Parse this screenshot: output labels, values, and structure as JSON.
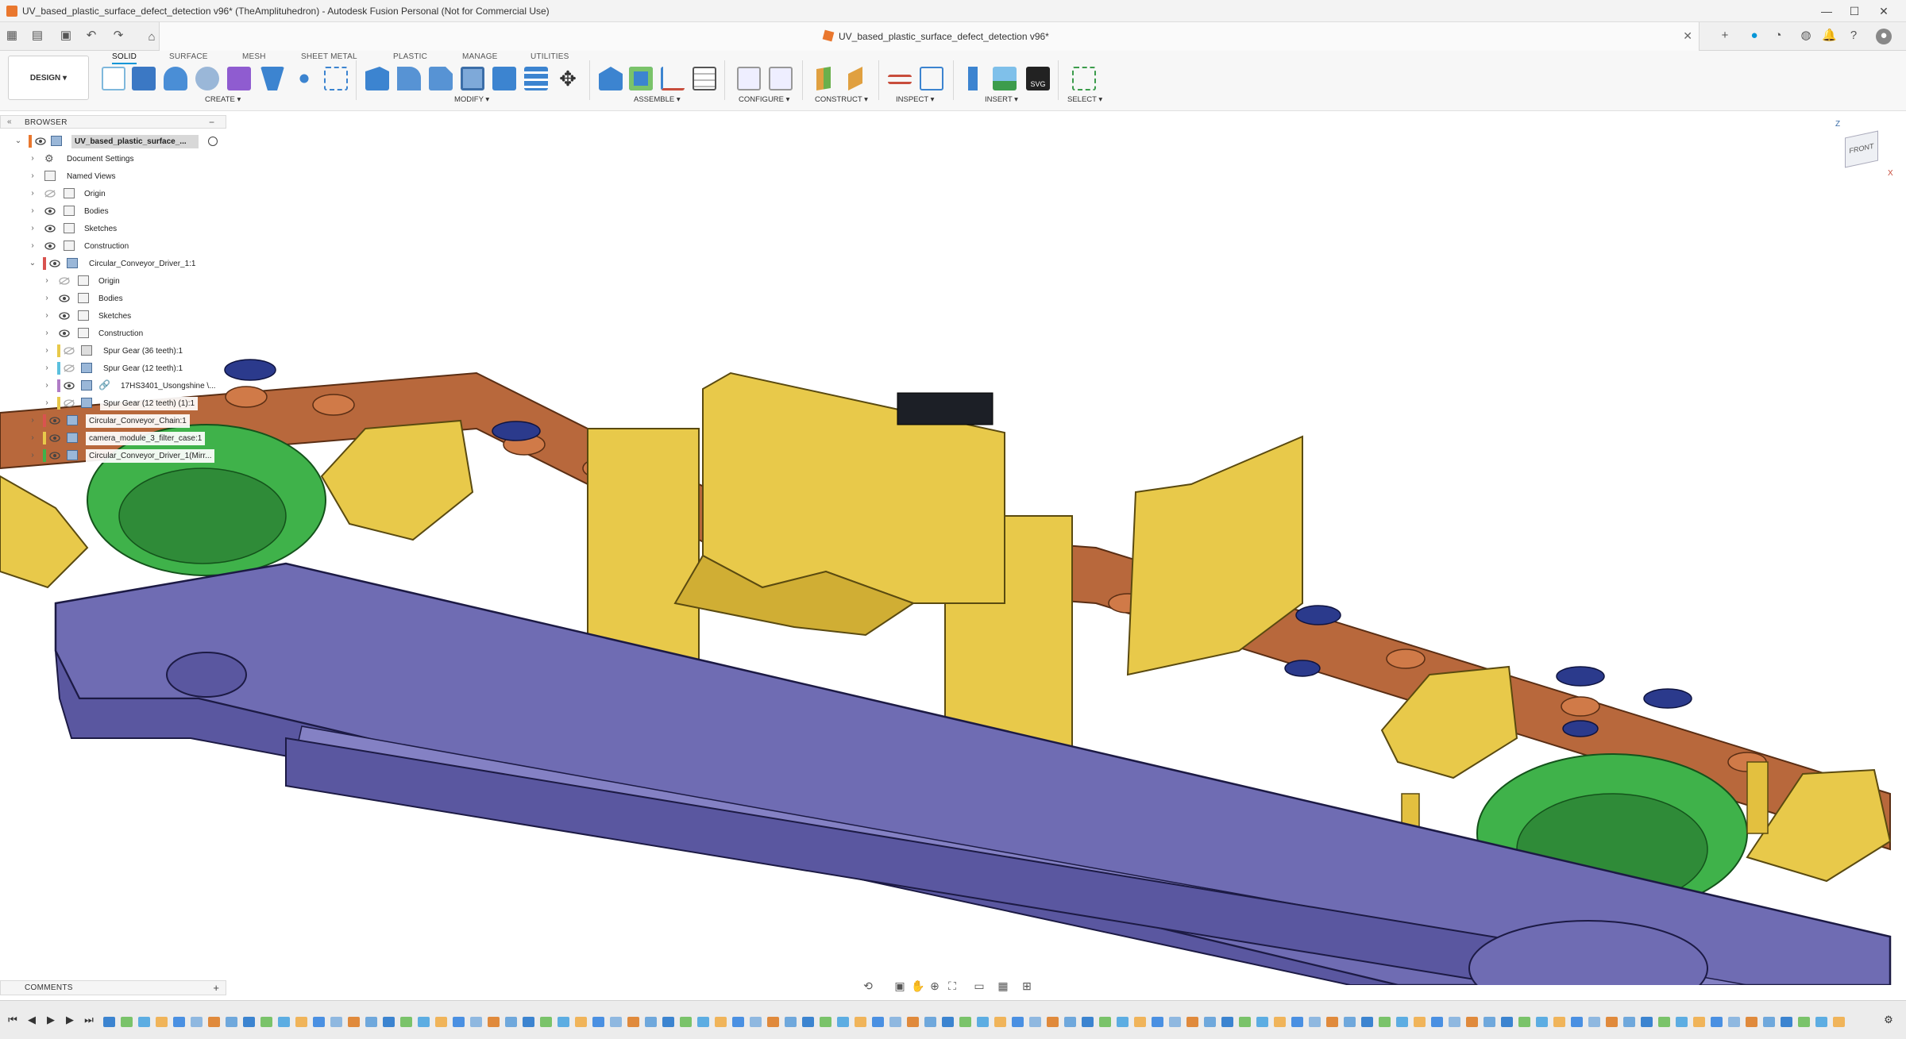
{
  "window": {
    "title": "UV_based_plastic_surface_defect_detection v96* (TheAmplituhedron) - Autodesk Fusion Personal (Not for Commercial Use)",
    "controls": [
      "—",
      "☐",
      "✕"
    ]
  },
  "document_tab": {
    "name": "UV_based_plastic_surface_defect_detection v96*",
    "close": "✕"
  },
  "toolbar": {
    "workspace": "DESIGN",
    "workspace_caret": "▾",
    "tabs": [
      "SOLID",
      "SURFACE",
      "MESH",
      "SHEET METAL",
      "PLASTIC",
      "MANAGE",
      "UTILITIES"
    ],
    "active_tab": "SOLID",
    "groups": [
      {
        "label": "CREATE ▾"
      },
      {
        "label": "MODIFY ▾"
      },
      {
        "label": "ASSEMBLE ▾"
      },
      {
        "label": "CONFIGURE ▾"
      },
      {
        "label": "CONSTRUCT ▾"
      },
      {
        "label": "INSPECT ▾"
      },
      {
        "label": "INSERT ▾"
      },
      {
        "label": "SELECT ▾"
      }
    ]
  },
  "browser": {
    "title": "BROWSER",
    "collapse": "−",
    "root": "UV_based_plastic_surface_...",
    "items": [
      {
        "label": "Document Settings"
      },
      {
        "label": "Named Views"
      },
      {
        "label": "Origin"
      },
      {
        "label": "Bodies"
      },
      {
        "label": "Sketches"
      },
      {
        "label": "Construction"
      },
      {
        "label": "Circular_Conveyor_Driver_1:1"
      },
      {
        "label": "Origin"
      },
      {
        "label": "Bodies"
      },
      {
        "label": "Sketches"
      },
      {
        "label": "Construction"
      },
      {
        "label": "Spur Gear (36 teeth):1"
      },
      {
        "label": "Spur Gear (12 teeth):1"
      },
      {
        "label": "17HS3401_Usongshine \\..."
      },
      {
        "label": "Spur Gear (12 teeth) (1):1"
      },
      {
        "label": "Circular_Conveyor_Chain:1"
      },
      {
        "label": "camera_module_3_filter_case:1"
      },
      {
        "label": "Circular_Conveyor_Driver_1(Mirr..."
      }
    ]
  },
  "comments": {
    "title": "COMMENTS",
    "add": "+"
  },
  "viewcube": {
    "face": "FRONT",
    "axis_x": "X",
    "axis_z": "Z"
  },
  "colors": {
    "accent": "#0696d7",
    "brand": "#e9772e",
    "body_purple": "#6f6cb3",
    "body_yellow": "#e8c94a",
    "body_copper": "#b8683c",
    "body_green": "#3fb24a",
    "body_navy": "#2b3a8c"
  }
}
